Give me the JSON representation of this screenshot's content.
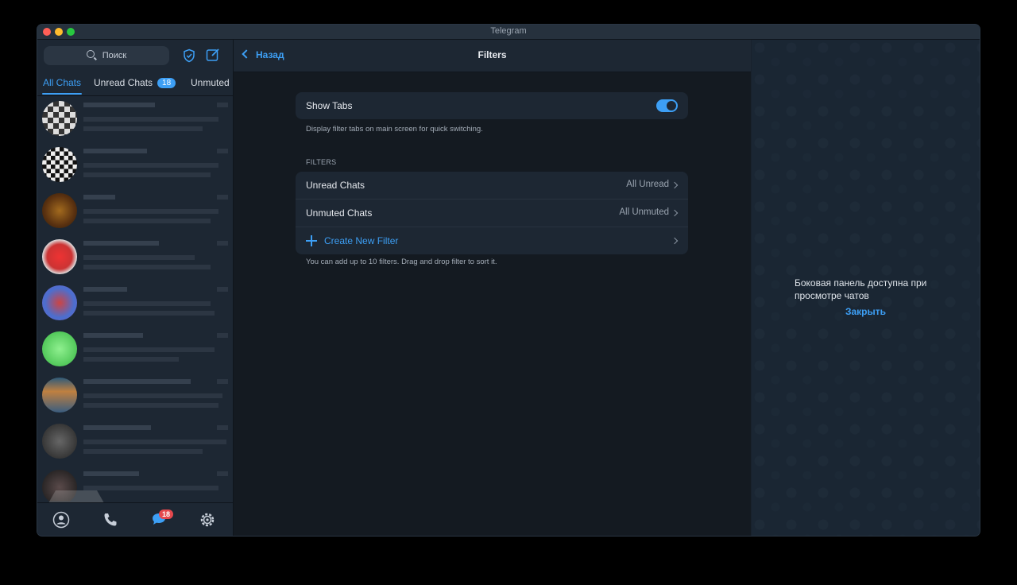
{
  "window": {
    "title": "Telegram"
  },
  "sidebar": {
    "search_placeholder": "Поиск",
    "tabs": [
      {
        "label": "All Chats"
      },
      {
        "label": "Unread Chats",
        "badge": "18"
      },
      {
        "label": "Unmuted"
      }
    ],
    "bottom_bar": {
      "chats_badge": "18"
    }
  },
  "header": {
    "back_label": "Назад",
    "title": "Filters"
  },
  "settings": {
    "show_tabs_label": "Show Tabs",
    "show_tabs_enabled": true,
    "show_tabs_hint": "Display filter tabs on main screen for quick switching.",
    "filters_section": "FILTERS",
    "filters": [
      {
        "name": "Unread Chats",
        "value": "All Unread"
      },
      {
        "name": "Unmuted Chats",
        "value": "All Unmuted"
      }
    ],
    "create_label": "Create New Filter",
    "filters_hint": "You can add up to 10 filters. Drag and drop filter to sort it."
  },
  "right_panel": {
    "text": "Боковая панель доступна при просмотре чатов",
    "close_label": "Закрыть"
  },
  "colors": {
    "accent": "#3d9ff5",
    "badge_red": "#e5484d"
  }
}
